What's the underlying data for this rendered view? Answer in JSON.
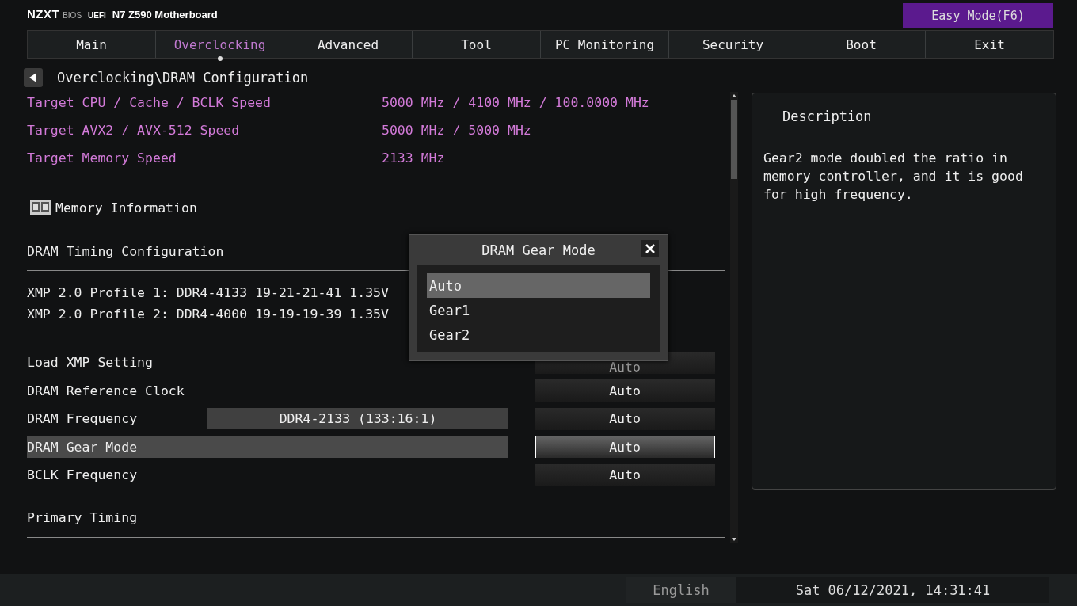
{
  "header": {
    "brand": "NZXT",
    "bios_label": "BIOS",
    "uefi_label": "UEFI",
    "board": "N7 Z590 Motherboard",
    "easy_mode_button": "Easy Mode(F6)"
  },
  "tabs": [
    {
      "label": "Main",
      "selected": false
    },
    {
      "label": "Overclocking",
      "selected": true
    },
    {
      "label": "Advanced",
      "selected": false
    },
    {
      "label": "Tool",
      "selected": false
    },
    {
      "label": "PC Monitoring",
      "selected": false
    },
    {
      "label": "Security",
      "selected": false
    },
    {
      "label": "Boot",
      "selected": false
    },
    {
      "label": "Exit",
      "selected": false
    }
  ],
  "breadcrumb": "Overclocking\\DRAM Configuration",
  "rows": [
    {
      "kind": "info",
      "label": "Target CPU / Cache / BCLK Speed",
      "value": "5000 MHz / 4100 MHz / 100.0000 MHz"
    },
    {
      "kind": "info",
      "label": "Target AVX2 / AVX-512 Speed",
      "value": "5000 MHz / 5000 MHz"
    },
    {
      "kind": "info",
      "label": "Target Memory Speed",
      "value": "2133 MHz"
    },
    {
      "kind": "link",
      "label": "Memory Information"
    },
    {
      "kind": "section",
      "label": "DRAM Timing Configuration"
    },
    {
      "kind": "text",
      "label": "XMP 2.0 Profile 1: DDR4-4133 19-21-21-41 1.35V"
    },
    {
      "kind": "text",
      "label": "XMP 2.0 Profile 2: DDR4-4000 19-19-19-39 1.35V"
    },
    {
      "kind": "setting",
      "label": "Load XMP Setting",
      "option": "Auto",
      "selected": false
    },
    {
      "kind": "setting",
      "label": "DRAM Reference Clock",
      "option": "Auto",
      "selected": false
    },
    {
      "kind": "setting",
      "label": "DRAM Frequency",
      "detail": "DDR4-2133 (133:16:1)",
      "option": "Auto",
      "selected": false
    },
    {
      "kind": "setting",
      "label": "DRAM Gear Mode",
      "option": "Auto",
      "selected": true
    },
    {
      "kind": "setting",
      "label": "BCLK Frequency",
      "option": "Auto",
      "selected": false
    },
    {
      "kind": "section",
      "label": "Primary Timing"
    }
  ],
  "description": {
    "title": "Description",
    "text": "Gear2 mode doubled the ratio in memory controller, and it is good for high frequency."
  },
  "popup": {
    "title": "DRAM Gear Mode",
    "options": [
      {
        "label": "Auto",
        "selected": true
      },
      {
        "label": "Gear1",
        "selected": false
      },
      {
        "label": "Gear2",
        "selected": false
      }
    ]
  },
  "status_bar": {
    "language": "English",
    "datetime": "Sat 06/12/2021, 14:31:41"
  }
}
